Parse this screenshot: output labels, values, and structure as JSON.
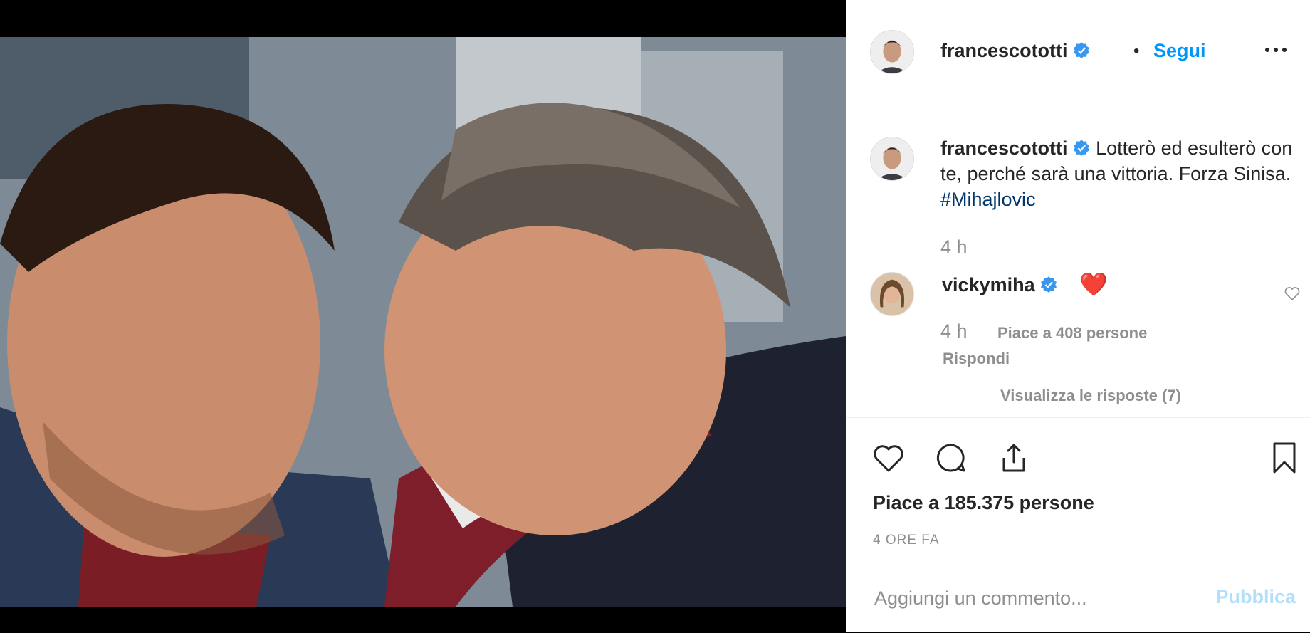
{
  "post": {
    "author": "francescototti",
    "follow_label": "Segui",
    "separator": "•",
    "more_icon": "more-horizontal-icon",
    "caption": {
      "username": "francescototti",
      "text": "Lotterò ed esulterò con te, perché sarà una vittoria. Forza Sinisa.",
      "hashtag": "#Mihajlovic",
      "age": "4 h"
    },
    "comments": [
      {
        "username": "vickymiha",
        "text": "❤️",
        "age": "4 h",
        "likes": "Piace a 408 persone",
        "reply": "Rispondi",
        "view_replies": "Visualizza le risposte (7)"
      }
    ],
    "likes_text": "Piace a 185.375 persone",
    "timestamp": "4 ORE FA",
    "add_comment": {
      "placeholder": "Aggiungi un commento...",
      "submit_label": "Pubblica"
    },
    "colors": {
      "link": "#0095f6",
      "hashtag": "#00376b",
      "verified": "#3897f0",
      "submit_disabled": "#b2dffc"
    }
  }
}
